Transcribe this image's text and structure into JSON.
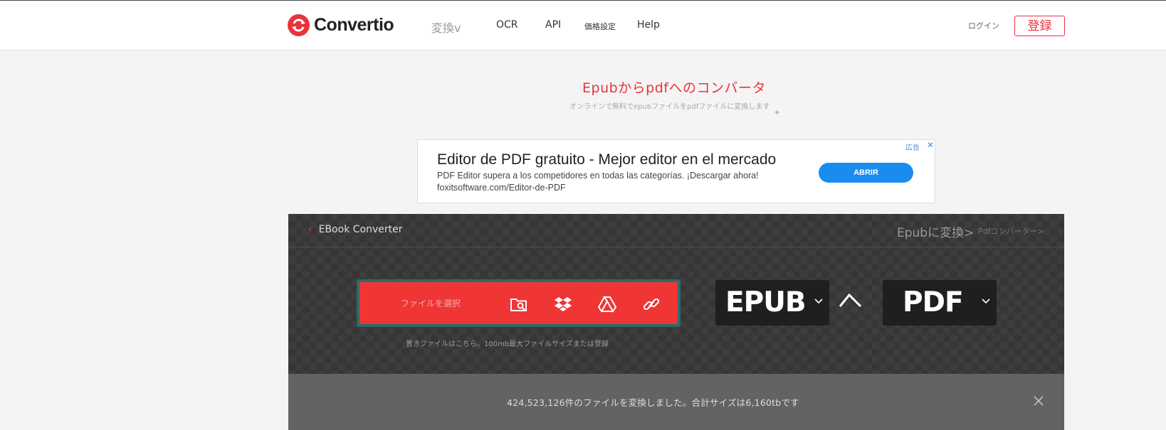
{
  "header": {
    "brand": "Convertio",
    "nav": {
      "convert": "変換v",
      "ocr": "OCR",
      "api": "API",
      "pricing": "価格設定",
      "help": "Help"
    },
    "login": "ログイン",
    "signup": "登録"
  },
  "hero": {
    "title": "Epubからpdfへのコンバータ",
    "subtitle": "オンラインで無料でepubファイルをpdfファイルに変換します"
  },
  "ad": {
    "title": "Editor de PDF gratuito - Mejor editor en el mercado",
    "description": "PDF Editor supera a los competidores en todas las categorías. ¡Descargar ahora!",
    "url": "foxitsoftware.com/Editor-de-PDF",
    "button": "ABRIR",
    "label": "広告",
    "close": "✕"
  },
  "converter": {
    "back_label": "EBook Converter",
    "convert_to_epub": "Epubに変換>",
    "pdf_converter": "Pdfコンバーター>",
    "upload_label": "ファイルを選択",
    "upload_hint": "置きファイルはこちら。100mb最大ファイルサイズまたは登録",
    "from_format": "EPUB",
    "to_format": "PDF",
    "icons": [
      "folder-search-icon",
      "dropbox-icon",
      "google-drive-icon",
      "link-icon"
    ]
  },
  "stats": {
    "text": "424,523,126件のファイルを変換しました。合計サイズは6,160tbです"
  },
  "colors": {
    "accent": "#e8343c",
    "upload_bg": "#f03535",
    "ad_button": "#1a8cf0",
    "panel_bg": "#3d3d3d"
  }
}
